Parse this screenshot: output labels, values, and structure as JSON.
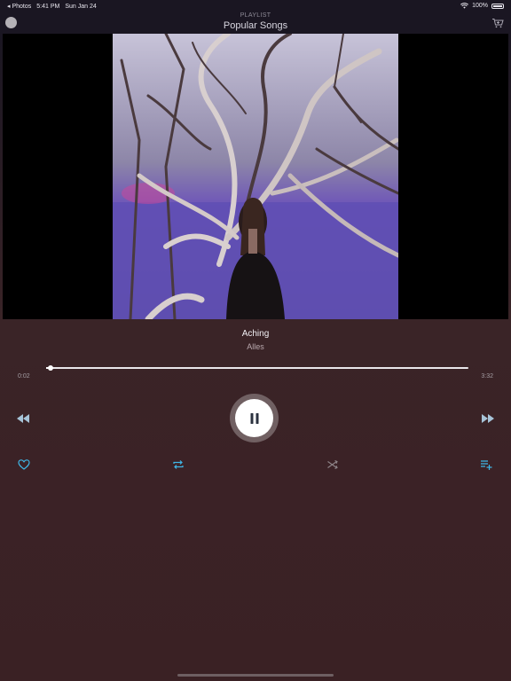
{
  "status_bar": {
    "back_app": "◂ Photos",
    "time": "5:41 PM",
    "date": "Sun Jan 24",
    "battery": "100%"
  },
  "header": {
    "subtitle": "PLAYLIST",
    "title": "Popular Songs"
  },
  "track": {
    "title": "Aching",
    "artist": "Alles",
    "elapsed": "0:02",
    "duration": "3:32",
    "progress_fraction": 0.01
  },
  "colors": {
    "accent": "#3fb6e6",
    "background": "#3a2326"
  },
  "icons": {
    "avatar": "profile-avatar",
    "cart": "cart-icon",
    "rewind": "rewind-icon",
    "play_pause": "pause-icon",
    "forward": "fast-forward-icon",
    "like": "heart-icon",
    "repeat": "repeat-icon",
    "shuffle": "shuffle-icon",
    "queue": "add-to-queue-icon"
  }
}
